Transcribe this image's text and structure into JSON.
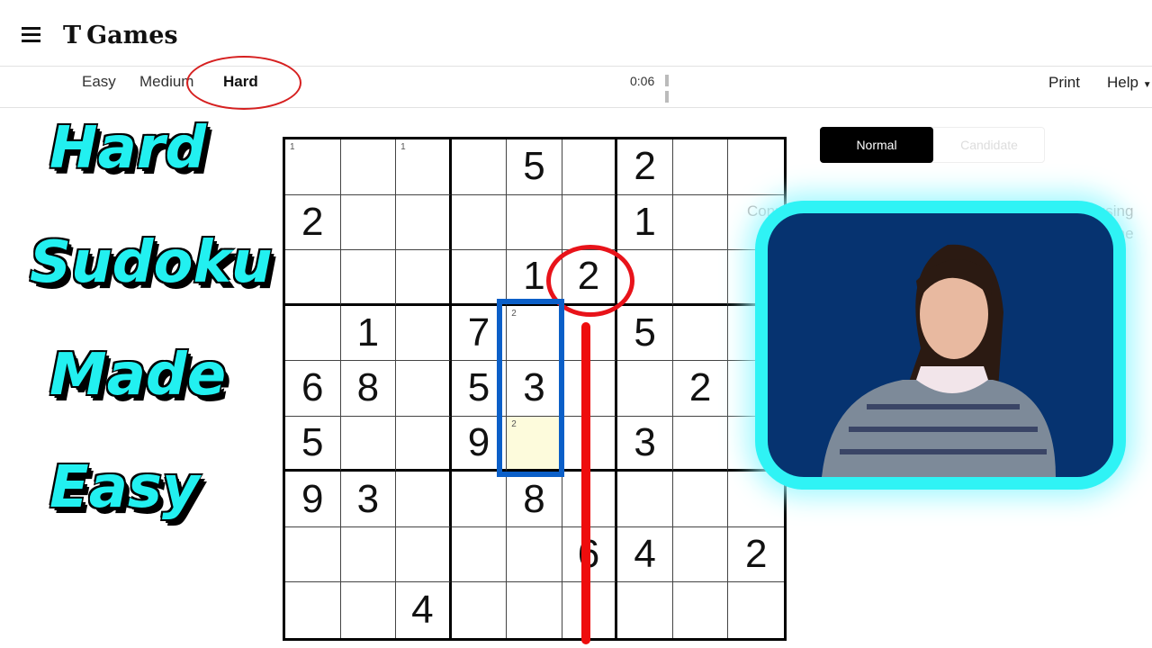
{
  "header": {
    "logo_mark": "T",
    "logo_text": "Games",
    "menu_icon": "hamburger-icon"
  },
  "toolbar": {
    "levels": [
      "Easy",
      "Medium",
      "Hard"
    ],
    "selected_level": "Hard",
    "timer": "0:06",
    "print": "Print",
    "help": "Help"
  },
  "overlay_title": [
    "Hard",
    "Sudoku",
    "Made",
    "Easy"
  ],
  "colors": {
    "title": "#22f0f0",
    "circle": "#e8131a",
    "rect": "#0b5fc8",
    "card": "#063370",
    "glow": "#2ff3f5",
    "highlight": "#fdfbdc"
  },
  "sudoku": {
    "rows": [
      [
        "",
        "",
        "",
        "",
        "5",
        "",
        "2",
        "",
        ""
      ],
      [
        "2",
        "",
        "",
        "",
        "",
        "",
        "1",
        "",
        ""
      ],
      [
        "",
        "",
        "",
        "",
        "1",
        "2",
        "",
        "",
        ""
      ],
      [
        "",
        "1",
        "",
        "7",
        "",
        "",
        "5",
        "",
        ""
      ],
      [
        "6",
        "8",
        "",
        "5",
        "3",
        "",
        "",
        "2",
        ""
      ],
      [
        "5",
        "",
        "",
        "9",
        "",
        "",
        "3",
        "",
        ""
      ],
      [
        "9",
        "3",
        "",
        "",
        "8",
        "",
        "",
        "",
        ""
      ],
      [
        "",
        "",
        "",
        "",
        "",
        "6",
        "4",
        "",
        "2"
      ],
      [
        "",
        "",
        "4",
        "",
        "",
        "",
        "",
        "",
        ""
      ]
    ],
    "notes": [
      [
        "1",
        "",
        "1",
        "",
        "",
        "",
        "",
        "",
        ""
      ],
      [
        "",
        "",
        "",
        "",
        "",
        "",
        "",
        "",
        ""
      ],
      [
        "",
        "",
        "",
        "",
        "",
        "",
        "",
        "",
        ""
      ],
      [
        "",
        "",
        "",
        "",
        "2",
        "",
        "",
        "",
        ""
      ],
      [
        "",
        "",
        "",
        "",
        "",
        "",
        "",
        "",
        ""
      ],
      [
        "",
        "",
        "",
        "",
        "2",
        "",
        "",
        "",
        ""
      ],
      [
        "",
        "",
        "",
        "",
        "",
        "",
        "",
        "",
        ""
      ],
      [
        "",
        "",
        "",
        "",
        "",
        "",
        "",
        "",
        ""
      ],
      [
        "",
        "",
        "",
        "",
        "",
        "",
        "",
        "",
        ""
      ]
    ]
  },
  "side": {
    "mode_normal": "Normal",
    "mode_candidate": "Candidate",
    "promo_left": "Connect the dots to",
    "promo_right": "Create words using",
    "promo_right2": "the"
  }
}
